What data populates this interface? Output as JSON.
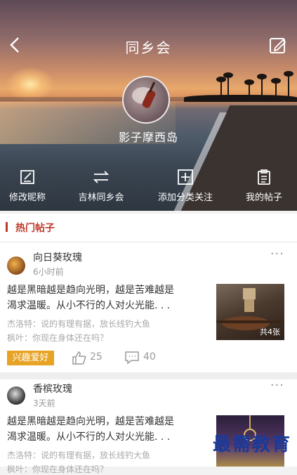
{
  "header": {
    "title": "同乡会",
    "back_icon": "chevron-left-icon",
    "edit_icon": "edit-icon"
  },
  "profile": {
    "username": "影子摩西岛"
  },
  "actions": [
    {
      "label": "修改昵称",
      "icon": "edit-square-icon"
    },
    {
      "label": "吉林同乡会",
      "icon": "swap-icon"
    },
    {
      "label": "添加分类关注",
      "icon": "plus-square-icon"
    },
    {
      "label": "我的帖子",
      "icon": "clipboard-icon"
    }
  ],
  "hot": {
    "title": "热门帖子"
  },
  "posts": [
    {
      "author": "向日葵玫瑰",
      "time": "6小时前",
      "text_line1": "越是黑暗越是趋向光明，越是苦难越是",
      "text_line2": "渴求温暖。从小不行的人对火光能. . .",
      "comment1": "杰洛特：说的有理有据，放长线钓大鱼",
      "comment2": "枫叶：你现在身体还在吗？",
      "image_count": "共4张",
      "tag": "兴趣爱好",
      "likes": "25",
      "comments": "40"
    },
    {
      "author": "香槟玫瑰",
      "time": "3天前",
      "text_line1": "越是黑暗越是趋向光明，越是苦难越是",
      "text_line2": "渴求温暖。从小不行的人对火光能. . .",
      "comment1": "杰洛特：说的有理有据，放长线钓大鱼",
      "comment2": "枫叶：你现在身体还在吗？"
    }
  ],
  "more_label": "···",
  "watermark": "最需教育",
  "colors": {
    "accent": "#c0392b",
    "tag": "#e6a324"
  }
}
